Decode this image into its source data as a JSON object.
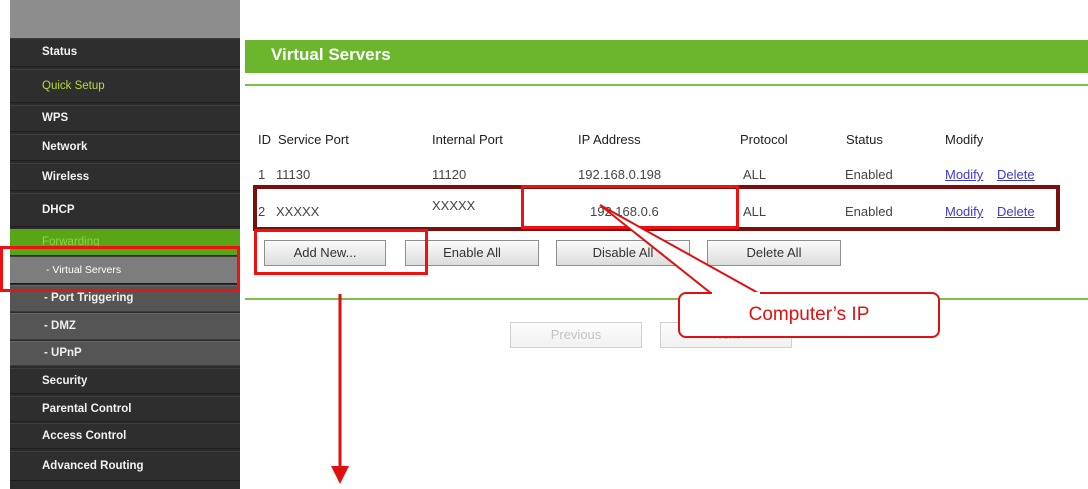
{
  "sidebar": {
    "items": [
      {
        "label": "Status",
        "style": ""
      },
      {
        "label": "Quick Setup",
        "style": "green"
      },
      {
        "label": "WPS",
        "style": ""
      },
      {
        "label": "Network",
        "style": ""
      },
      {
        "label": "Wireless",
        "style": ""
      },
      {
        "label": "DHCP",
        "style": ""
      },
      {
        "label": "Forwarding",
        "style": "forwarding"
      },
      {
        "label": "- Virtual Servers",
        "style": "active"
      },
      {
        "label": "- Port Triggering",
        "style": "sub"
      },
      {
        "label": "- DMZ",
        "style": "sub"
      },
      {
        "label": "- UPnP",
        "style": "sub"
      },
      {
        "label": "Security",
        "style": ""
      },
      {
        "label": "Parental Control",
        "style": ""
      },
      {
        "label": "Access Control",
        "style": ""
      },
      {
        "label": "Advanced Routing",
        "style": ""
      }
    ]
  },
  "main": {
    "title": "Virtual Servers",
    "columns": [
      "ID",
      "Service Port",
      "Internal Port",
      "IP Address",
      "Protocol",
      "Status",
      "Modify"
    ],
    "rows": [
      {
        "id": "1",
        "service_port": "11130",
        "internal_port": "11120",
        "ip": "192.168.0.198",
        "protocol": "ALL",
        "status": "Enabled",
        "modify": "Modify",
        "delete": "Delete"
      },
      {
        "id": "2",
        "service_port": "XXXXX",
        "internal_port": "XXXXX",
        "ip": "192.168.0.6",
        "protocol": "ALL",
        "status": "Enabled",
        "modify": "Modify",
        "delete": "Delete"
      }
    ],
    "buttons": {
      "add_new": "Add New...",
      "enable_all": "Enable All",
      "disable_all": "Disable All",
      "delete_all": "Delete All",
      "previous": "Previous",
      "next": "Next"
    }
  },
  "annotation": {
    "callout_text": "Computer’s IP",
    "highlight_color": "#ee1111",
    "row_box_color": "#7a0f0f"
  },
  "colors": {
    "header_green": "#6cb62e",
    "sidebar_dark": "#2b2b2b",
    "forwarding_green": "#5aa516",
    "link_blue": "#3b3bd0"
  }
}
